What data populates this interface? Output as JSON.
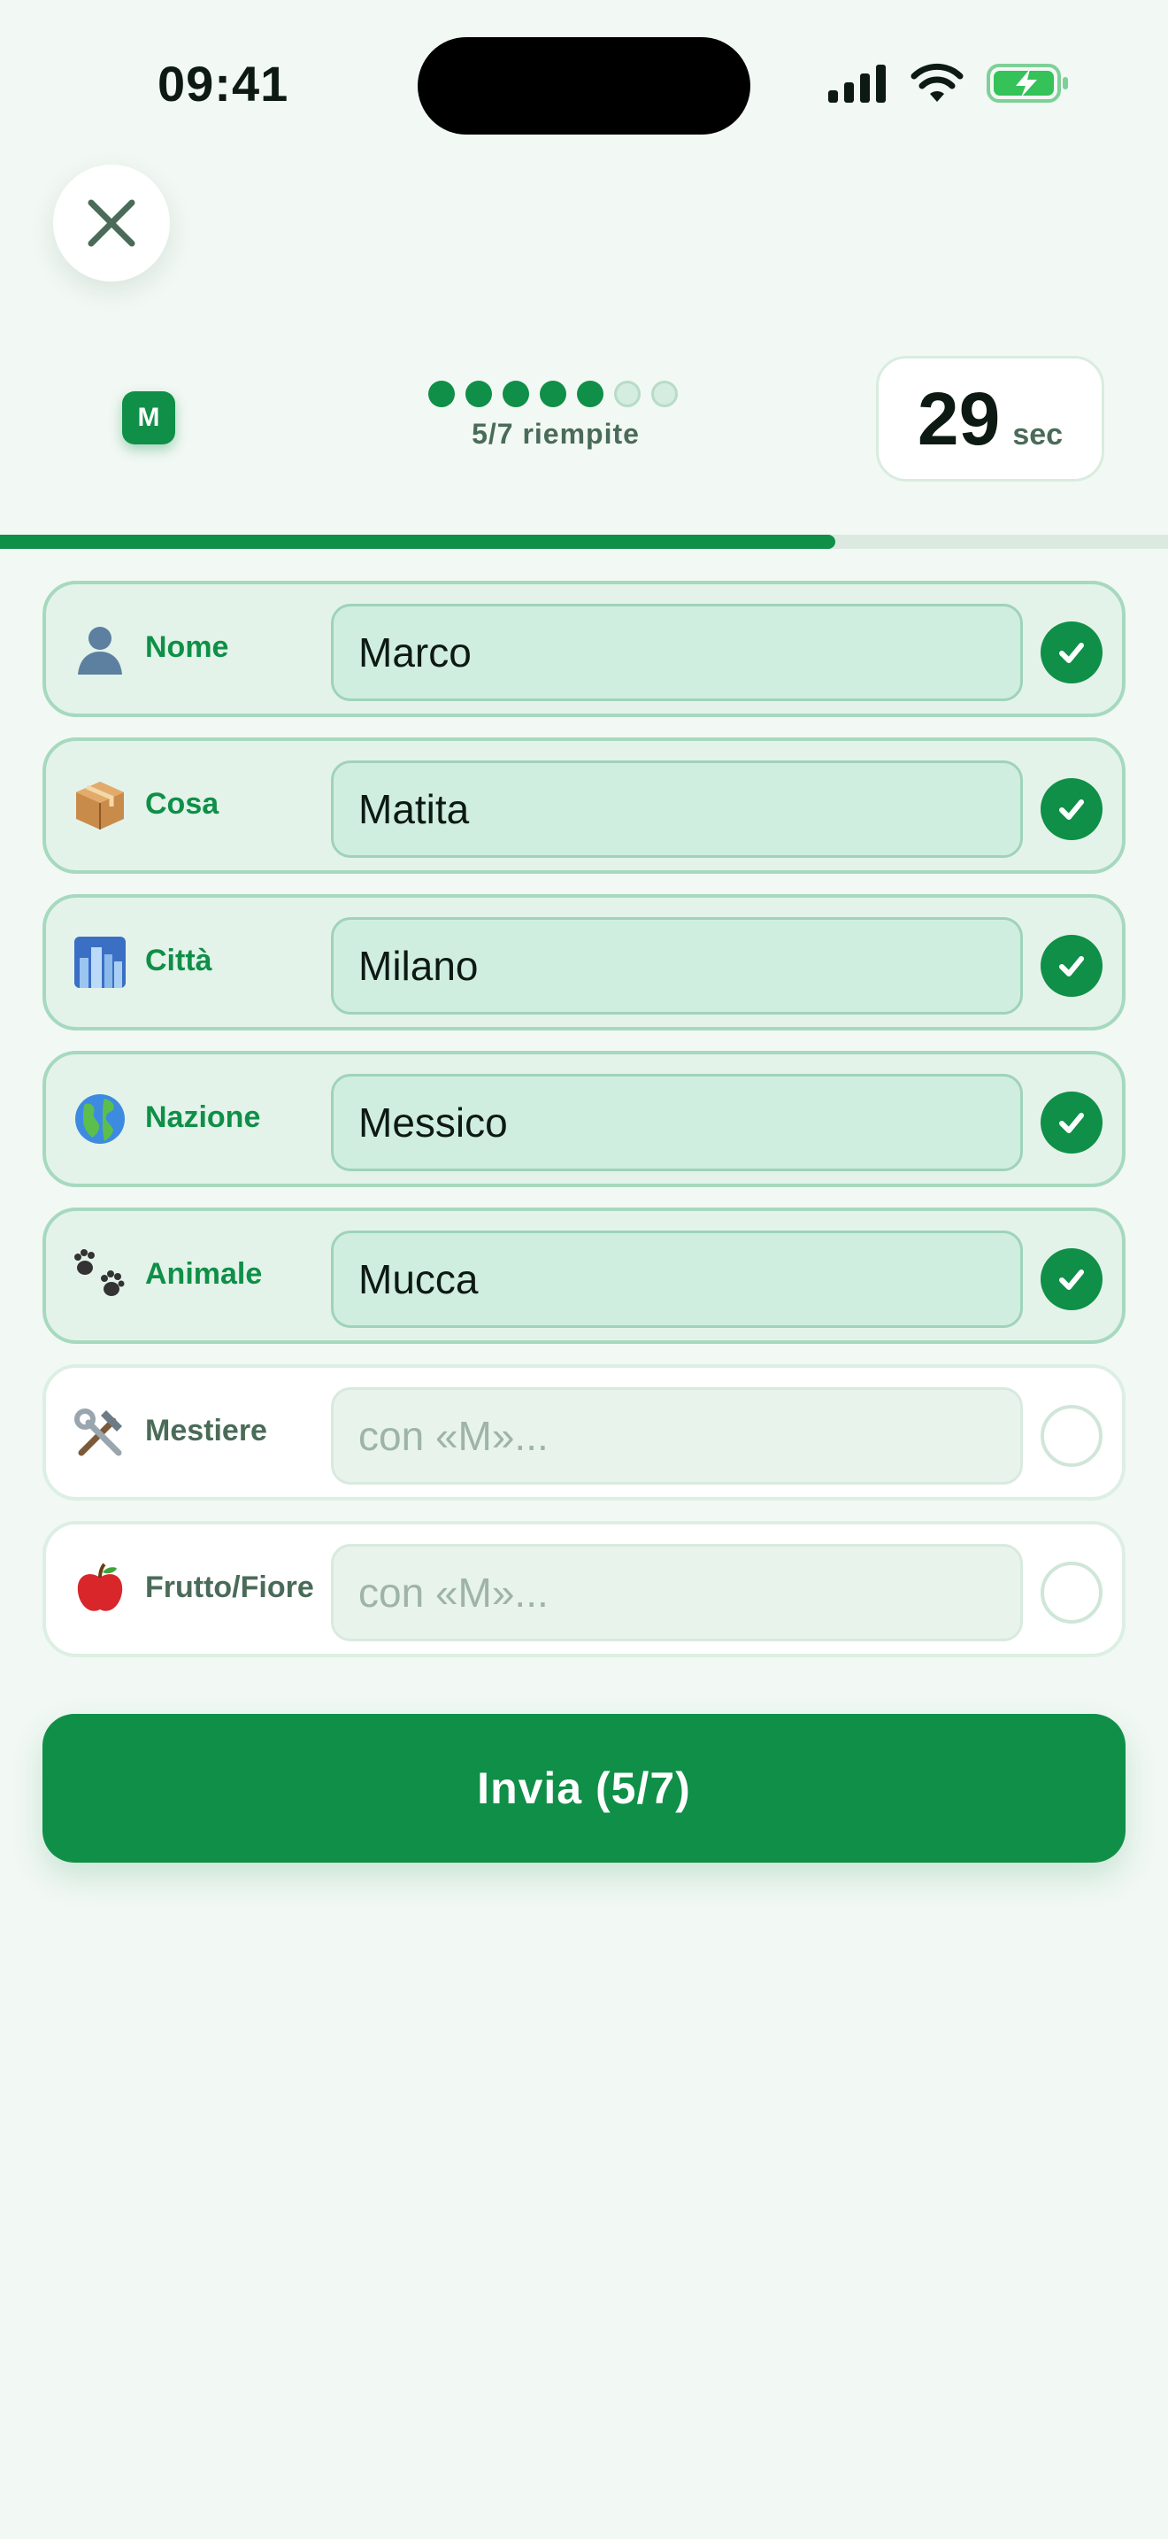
{
  "status_bar": {
    "time": "09:41"
  },
  "header": {
    "letter": "M",
    "dots": [
      true,
      true,
      true,
      true,
      true,
      false,
      false
    ],
    "filled_text": "5/7 riempite",
    "timer_value": "29",
    "timer_unit": "sec",
    "progress": 0.714
  },
  "rows": [
    {
      "icon": "person-silhouette-icon",
      "emoji": "👤",
      "label": "Nome",
      "value": "Marco",
      "placeholder": "",
      "done": true
    },
    {
      "icon": "package-icon",
      "emoji": "📦",
      "label": "Cosa",
      "value": "Matita",
      "placeholder": "",
      "done": true
    },
    {
      "icon": "city-icon",
      "emoji": "🏙️",
      "label": "Città",
      "value": "Milano",
      "placeholder": "",
      "done": true
    },
    {
      "icon": "globe-icon",
      "emoji": "🌍",
      "label": "Nazione",
      "value": "Messico",
      "placeholder": "",
      "done": true
    },
    {
      "icon": "paw-prints-icon",
      "emoji": "🐾",
      "label": "Animale",
      "value": "Mucca",
      "placeholder": "",
      "done": true
    },
    {
      "icon": "hammer-wrench-icon",
      "emoji": "🛠️",
      "label": "Mestiere",
      "value": "",
      "placeholder": "con «M»...",
      "done": false
    },
    {
      "icon": "apple-icon",
      "emoji": "🍎",
      "label": "Frutto/Fiore",
      "value": "",
      "placeholder": "con «M»...",
      "done": false
    }
  ],
  "submit_label": "Invia  (5/7)",
  "colors": {
    "accent": "#0f8f47",
    "background": "#f2f8f4",
    "done_row": "#e3f3ea"
  }
}
